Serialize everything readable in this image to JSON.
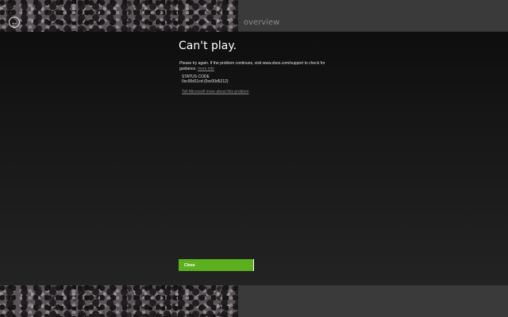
{
  "header": {
    "section_title": "overview",
    "back_icon": "arrow-left-circle-icon"
  },
  "dialog": {
    "title": "Can't play.",
    "message": "Please try again. If the problem continues, visit www.xbox.com/support to check for guidance.",
    "more_info_label": "more info",
    "status_label": "STATUS CODE",
    "status_code": "0xc00d11cd (0xc00d5212)",
    "tell_microsoft_label": "Tell Microsoft more about this problem",
    "close_label": "Close"
  },
  "colors": {
    "accent": "#5db01d",
    "dialog_bg": "#141414",
    "chrome_bg": "#3a3a3a"
  }
}
